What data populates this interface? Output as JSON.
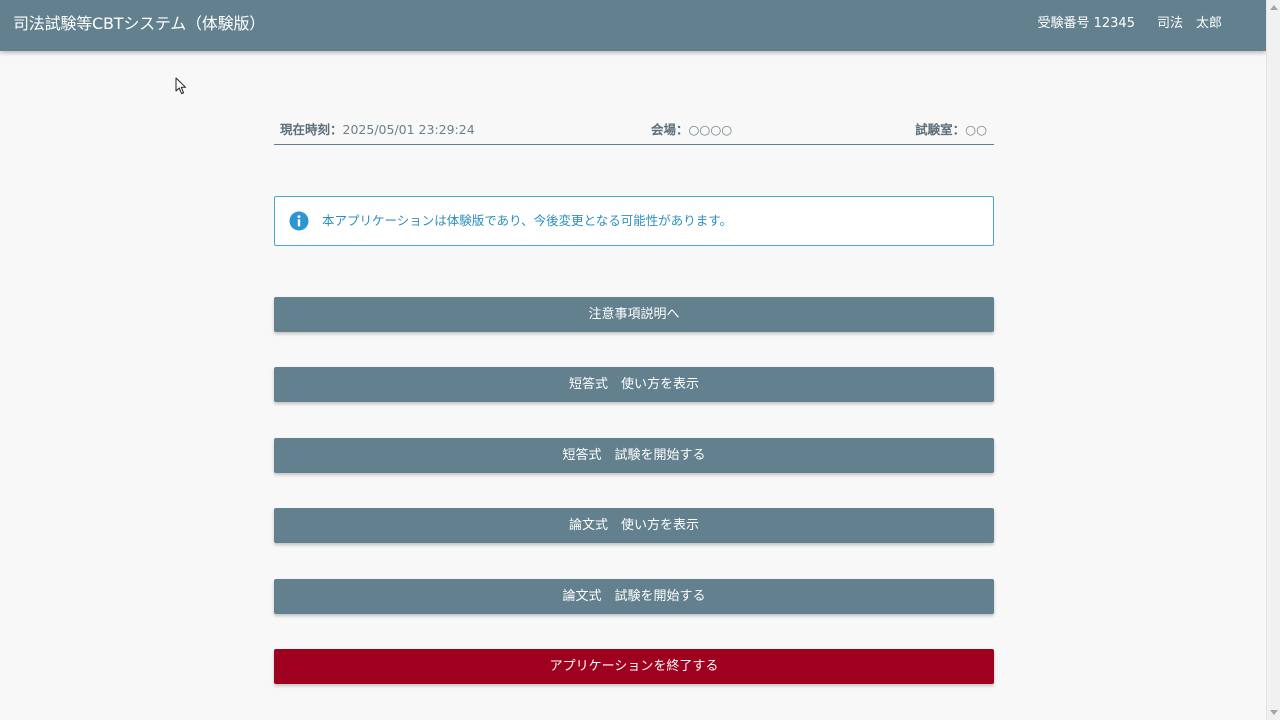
{
  "header": {
    "title": "司法試験等CBTシステム（体験版）",
    "exam_number": "受験番号 12345",
    "user_name": "司法　太郎",
    "bar_color": "#62808d"
  },
  "status": {
    "time_label": "現在時刻：",
    "time_value": "2025/05/01 23:29:24",
    "venue_label": "会場：",
    "venue_value": "○○○○",
    "room_label": "試験室：",
    "room_value": "○○"
  },
  "notice": {
    "icon": "info-icon",
    "text": "本アプリケーションは体験版であり、今後変更となる可能性があります。",
    "color": "#2d8fc0"
  },
  "actions": {
    "precautions": "注意事項説明へ",
    "short_answer_howto": "短答式　使い方を表示",
    "short_answer_start": "短答式　試験を開始する",
    "essay_howto": "論文式　使い方を表示",
    "essay_start": "論文式　試験を開始する",
    "exit": "アプリケーションを終了する",
    "primary_color": "#62808d",
    "danger_color": "#a00020"
  }
}
